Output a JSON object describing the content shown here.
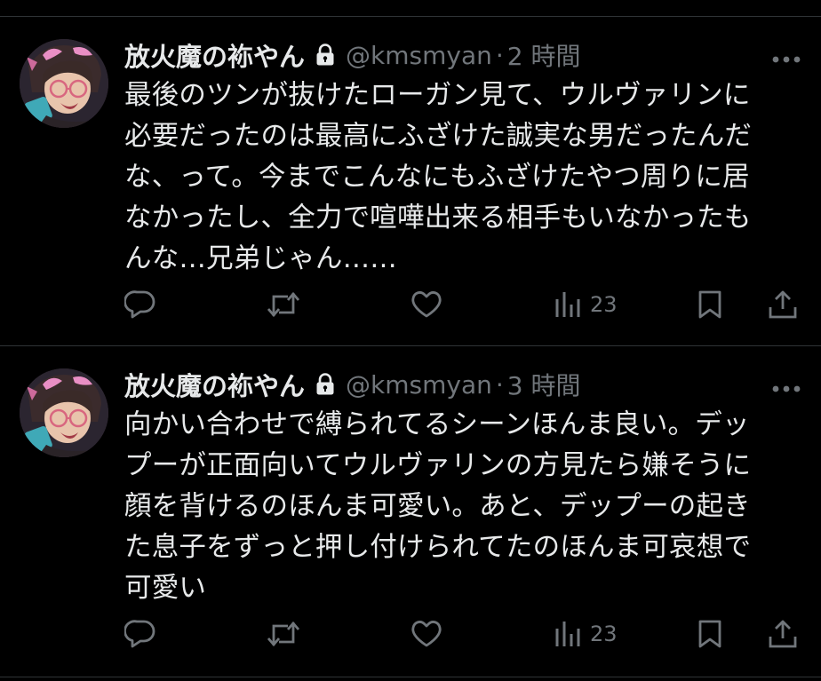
{
  "colors": {
    "background": "#000000",
    "text_primary": "#e7e9ea",
    "text_secondary": "#71767b",
    "divider": "#2f3336"
  },
  "posts": [
    {
      "display_name": "放火魔の袮やん",
      "lock_icon": "lock-icon",
      "handle": "@kmsmyan",
      "separator": "·",
      "time": "2 時間",
      "text": "最後のツンが抜けたローガン見て、ウルヴァリンに\n必要だったのは最高にふざけた誠実な男だったんだ\nな、って。今までこんなにもふざけたやつ周りに居\nなかったし、全力で喧嘩出来る相手もいなかったも\nんな…兄弟じゃん……",
      "views": "23",
      "icons": [
        "reply-icon",
        "repost-icon",
        "like-icon",
        "views-icon",
        "bookmark-icon",
        "share-icon"
      ]
    },
    {
      "display_name": "放火魔の袮やん",
      "lock_icon": "lock-icon",
      "handle": "@kmsmyan",
      "separator": "·",
      "time": "3 時間",
      "text": "向かい合わせで縛られてるシーンほんま良い。デッ\nプーが正面向いてウルヴァリンの方見たら嫌そうに\n顔を背けるのほんま可愛い。あと、デップーの起き\nた息子をずっと押し付けられてたのほんま可哀想で\n可愛い",
      "views": "23",
      "icons": [
        "reply-icon",
        "repost-icon",
        "like-icon",
        "views-icon",
        "bookmark-icon",
        "share-icon"
      ]
    }
  ]
}
